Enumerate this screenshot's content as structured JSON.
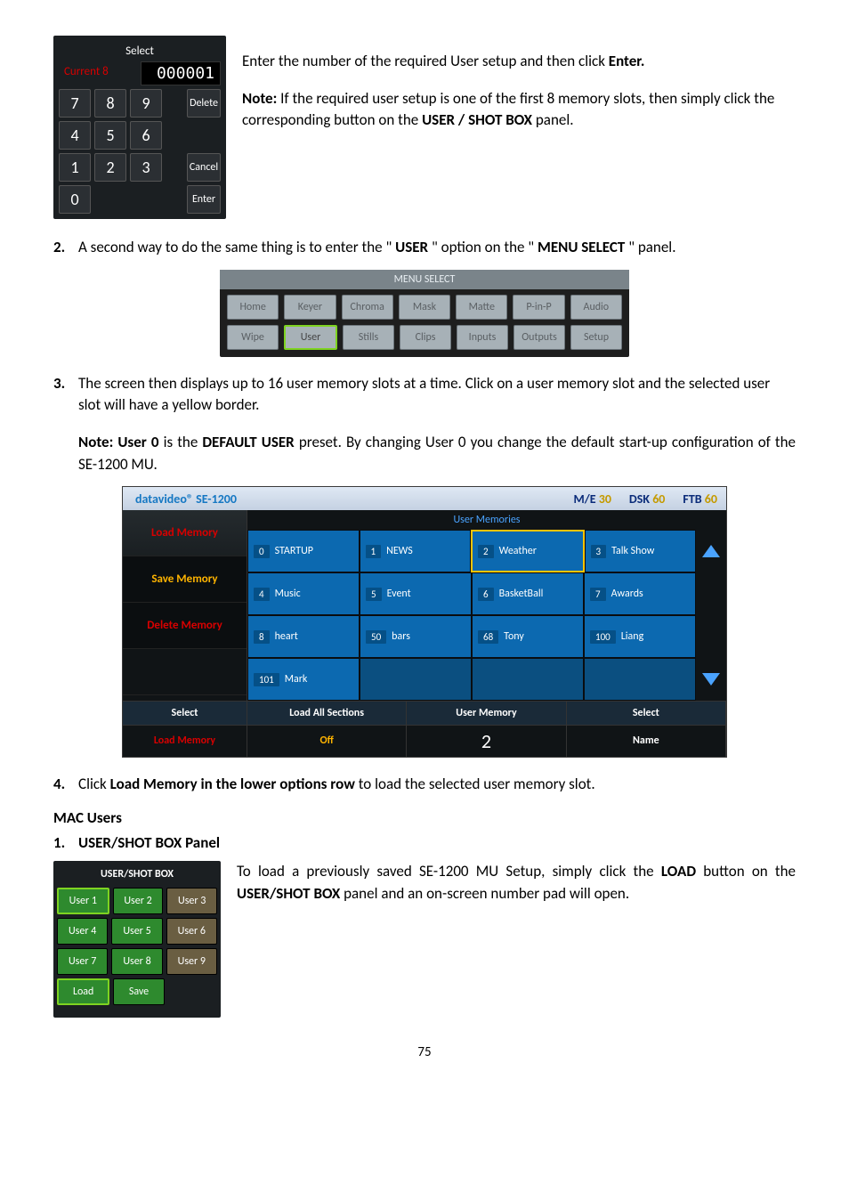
{
  "numpad": {
    "title": "Select",
    "current_label": "Current 8",
    "display": "000001",
    "keys": [
      [
        "7",
        "8",
        "9"
      ],
      [
        "4",
        "5",
        "6"
      ],
      [
        "1",
        "2",
        "3"
      ],
      [
        "0"
      ]
    ],
    "side": {
      "delete": "Delete",
      "cancel": "Cancel",
      "enter": "Enter"
    }
  },
  "intro": {
    "line1_a": "Enter the number of the required User setup and then click ",
    "line1_b": "Enter.",
    "note_label": "Note:",
    "note_body_a": " If the required user setup is one of the first 8 memory slots, then simply click the corresponding button on the ",
    "note_body_b": "USER / SHOT BOX",
    "note_body_c": " panel."
  },
  "step2": {
    "num": "2.",
    "text_a": "A second way to do the same thing is to enter the \"",
    "text_b": "USER",
    "text_c": "\" option on the \"",
    "text_d": "MENU SELECT",
    "text_e": "\" panel."
  },
  "menu_select": {
    "title": "MENU SELECT",
    "row1": [
      "Home",
      "Keyer",
      "Chroma",
      "Mask",
      "Matte",
      "P-in-P",
      "Audio"
    ],
    "row2": [
      "Wipe",
      "User",
      "Stills",
      "Clips",
      "Inputs",
      "Outputs",
      "Setup"
    ]
  },
  "step3": {
    "num": "3.",
    "text": "The screen then displays up to 16 user memory slots at a time. Click on a user memory slot and the selected user slot will have a yellow border.",
    "note_a": "Note: User 0",
    "note_b": " is the ",
    "note_c": "DEFAULT USER",
    "note_d": " preset. By changing User 0 you change the default start-up configuration of the SE-1200 MU."
  },
  "memory": {
    "logo": "datavideo® SE-1200",
    "header": [
      {
        "lbl": "M/E",
        "val": "30"
      },
      {
        "lbl": "DSK",
        "val": "60"
      },
      {
        "lbl": "FTB",
        "val": "60"
      }
    ],
    "grid_title": "User Memories",
    "side": {
      "load": "Load Memory",
      "save": "Save Memory",
      "delete": "Delete Memory"
    },
    "rows": [
      [
        {
          "n": "0",
          "t": "STARTUP"
        },
        {
          "n": "1",
          "t": "NEWS"
        },
        {
          "n": "2",
          "t": "Weather",
          "sel": true
        },
        {
          "n": "3",
          "t": "Talk Show"
        }
      ],
      [
        {
          "n": "4",
          "t": "Music"
        },
        {
          "n": "5",
          "t": "Event"
        },
        {
          "n": "6",
          "t": "BasketBall"
        },
        {
          "n": "7",
          "t": "Awards"
        }
      ],
      [
        {
          "n": "8",
          "t": "heart"
        },
        {
          "n": "50",
          "t": "bars"
        },
        {
          "n": "68",
          "t": "Tony"
        },
        {
          "n": "100",
          "t": "Liang"
        }
      ],
      [
        {
          "n": "101",
          "t": "Mark"
        },
        {
          "n": "",
          "t": ""
        },
        {
          "n": "",
          "t": ""
        },
        {
          "n": "",
          "t": ""
        }
      ]
    ],
    "footer_head": [
      "Select",
      "Load All Sections",
      "User Memory",
      "Select"
    ],
    "footer_vals": {
      "load": "Load Memory",
      "sec": "Off",
      "num": "2",
      "name": "Name"
    }
  },
  "step4": {
    "num": "4.",
    "text_a": "Click ",
    "text_b": "Load Memory in the lower options row",
    "text_c": " to load the selected user memory slot."
  },
  "mac": {
    "heading": "MAC Users",
    "step1_num": "1.",
    "step1_text": "USER/SHOT BOX Panel"
  },
  "usb": {
    "title": "USER/SHOT BOX",
    "rows": [
      [
        "User 1",
        "User 2",
        "User 3"
      ],
      [
        "User 4",
        "User 5",
        "User 6"
      ],
      [
        "User 7",
        "User 8",
        "User 9"
      ]
    ],
    "bottom": [
      "Load",
      "Save"
    ]
  },
  "mac_body": {
    "a": "To load a previously saved SE-1200 MU Setup, simply click the ",
    "b": "LOAD",
    "c": " button on the ",
    "d": "USER/SHOT BOX",
    "e": " panel and an on-screen number pad will open."
  },
  "page": "75"
}
